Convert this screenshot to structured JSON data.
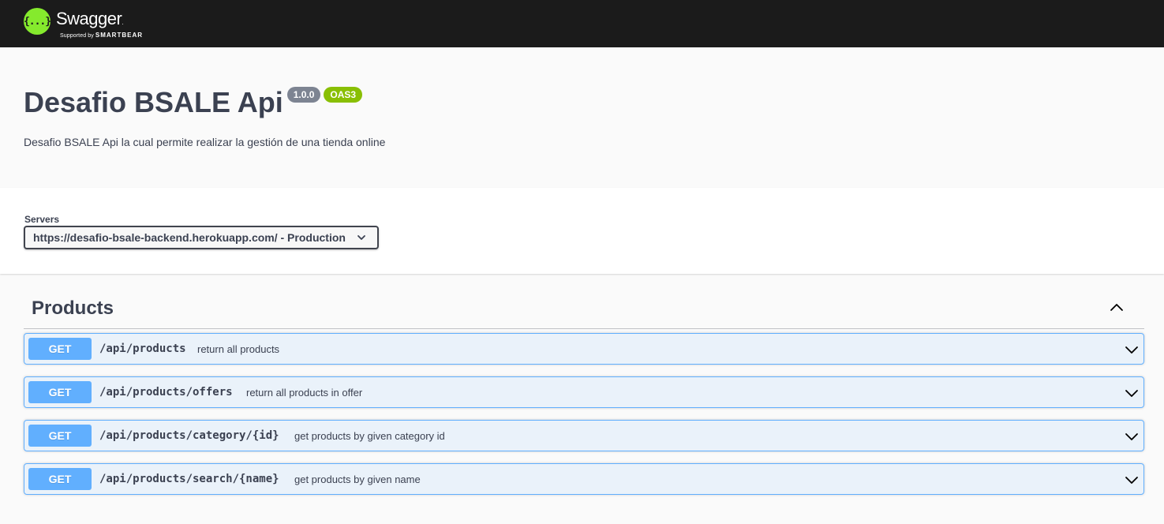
{
  "topbar": {
    "logo_glyph": "{...}",
    "logo_name": "Swagger",
    "logo_name_dot": ".",
    "logo_sub_prefix": "Supported by ",
    "logo_sub_brand": "SMARTBEAR"
  },
  "info": {
    "title": "Desafio BSALE Api",
    "version": "1.0.0",
    "oas": "OAS3",
    "description": "Desafio BSALE Api la cual permite realizar la gestión de una tienda online"
  },
  "servers": {
    "label": "Servers",
    "selected": "https://desafio-bsale-backend.herokuapp.com/ - Production"
  },
  "tag": {
    "name": "Products"
  },
  "operations": [
    {
      "method": "GET",
      "path": "/api/products",
      "summary": "return all products"
    },
    {
      "method": "GET",
      "path": "/api/products/offers",
      "summary": "return all products in offer"
    },
    {
      "method": "GET",
      "path": "/api/products/category/{id}",
      "summary": "get products by given category id"
    },
    {
      "method": "GET",
      "path": "/api/products/search/{name}",
      "summary": "get products by given name"
    }
  ],
  "colors": {
    "topbar_bg": "#1b1b1b",
    "logo_green": "#85ea2d",
    "get_blue": "#61affe",
    "version_badge": "#7d8492",
    "oas_badge": "#89bf04",
    "text": "#3b4151"
  },
  "icons": {
    "logo": "swagger-logo-icon",
    "select": "chevron-down-icon",
    "tag_toggle": "chevron-up-icon",
    "operation_expand": "chevron-down-icon"
  }
}
